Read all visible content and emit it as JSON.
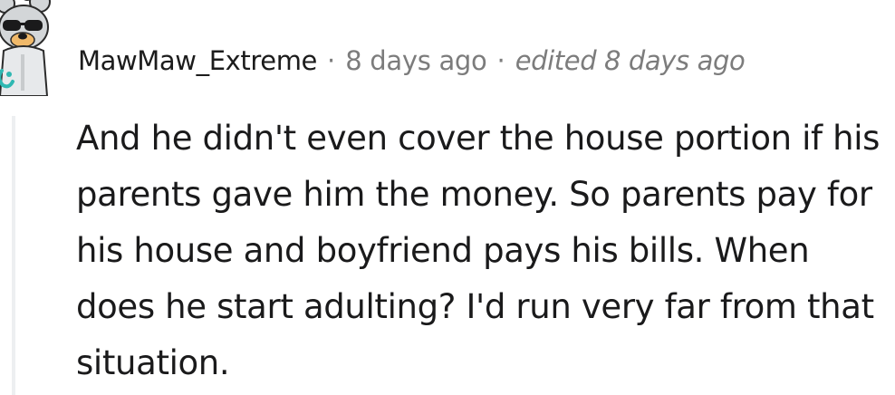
{
  "comment": {
    "author": "MawMaw_Extreme",
    "separator": "·",
    "timestamp": "8 days ago",
    "edited": "edited 8 days ago",
    "body": "And he didn't even cover the house portion if his parents gave him the money. So parents pay for his house and boyfriend pays his bills. When does he start adulting? I'd run very far from that situation."
  },
  "avatar": {
    "icon": "snoo-sunglasses-avatar-icon"
  },
  "colors": {
    "author": "#1c1c1c",
    "meta": "#7c7c7c",
    "body": "#1a1a1b",
    "thread_line": "#edeff1"
  }
}
